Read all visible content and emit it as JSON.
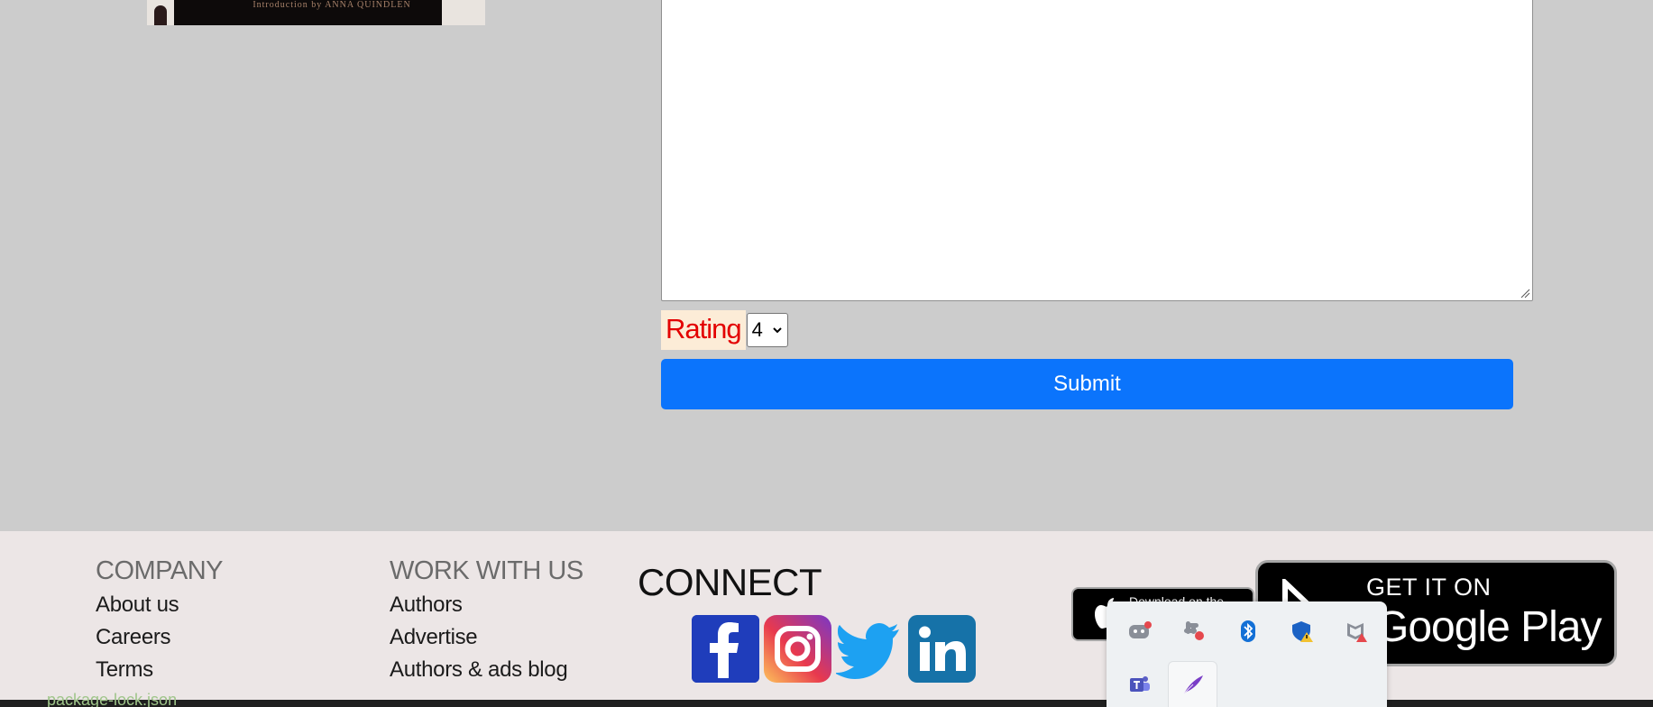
{
  "book": {
    "intro_text": "Introduction by ANNA QUINDLEN"
  },
  "review": {
    "textarea_value": ""
  },
  "rating": {
    "label": "Rating",
    "selected": "4"
  },
  "submit": {
    "label": "Submit"
  },
  "footer": {
    "company": {
      "heading": "COMPANY",
      "links": [
        "About us",
        "Careers",
        "Terms"
      ]
    },
    "work": {
      "heading": "WORK WITH US",
      "links": [
        "Authors",
        "Advertise",
        "Authors & ads blog"
      ]
    },
    "connect": {
      "heading": "CONNECT",
      "socials": [
        "facebook-icon",
        "instagram-icon",
        "twitter-icon",
        "linkedin-icon"
      ]
    },
    "app_store": {
      "small_text": "Download on the"
    },
    "google_play": {
      "line1": "GET IT ON",
      "line2": "Google Play"
    }
  },
  "taskbar": {
    "file_text": "package-lock.json"
  },
  "tray": {
    "icons": [
      "discord-icon",
      "slack-icon",
      "bluetooth-icon",
      "windows-security-icon",
      "mcafee-icon",
      "teams-icon",
      "quill-icon"
    ]
  },
  "colors": {
    "page_bg": "#cccccc",
    "submit_blue": "#0b74fc",
    "rating_red": "#e30000",
    "footer_bg": "#ece6e6"
  }
}
